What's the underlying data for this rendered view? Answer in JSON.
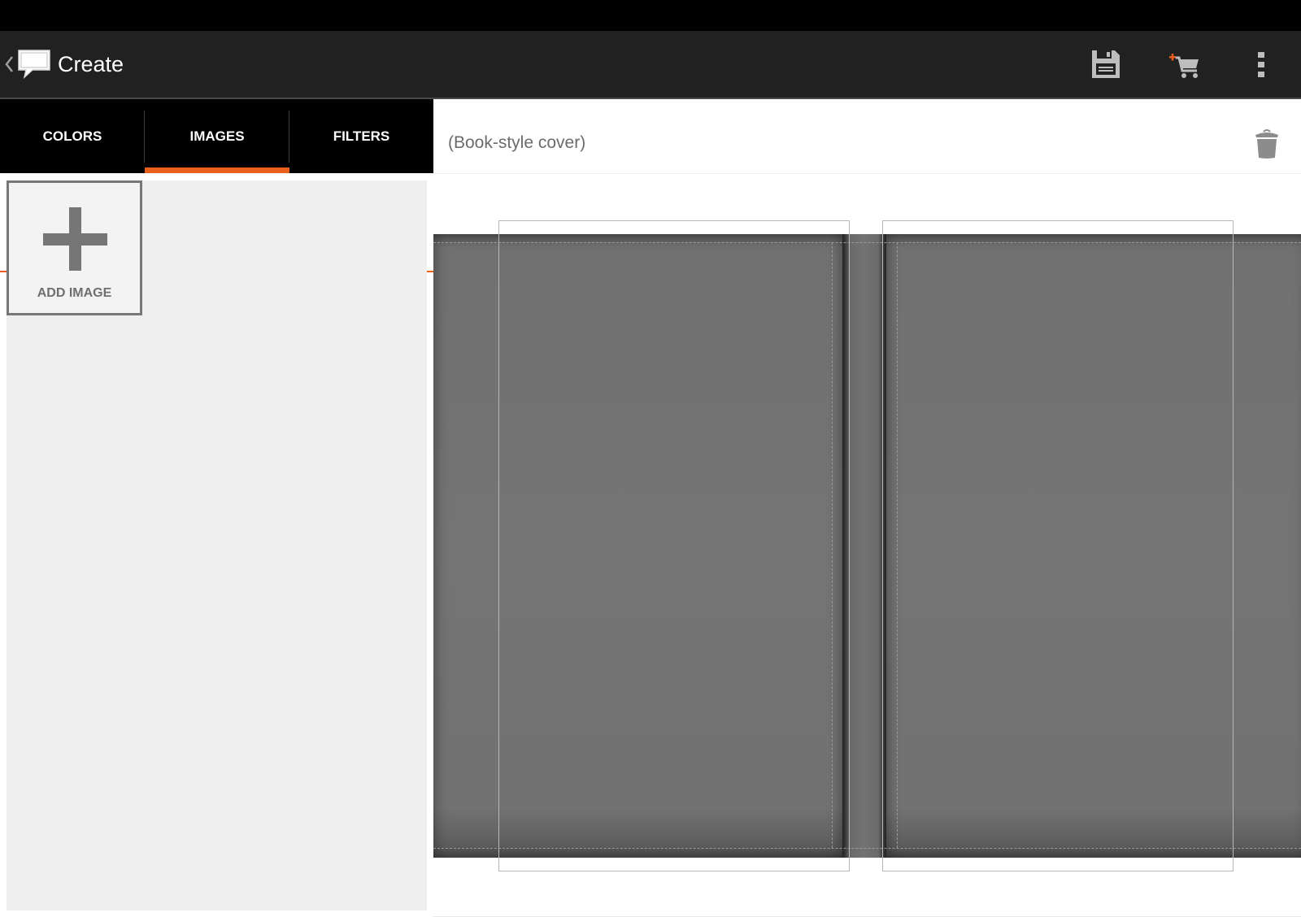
{
  "action_bar": {
    "title": "Create",
    "icons": {
      "up": "chevron-left-icon",
      "app": "speech-bubble-icon",
      "save": "floppy-disk-icon",
      "cart": "add-to-cart-icon",
      "overflow": "overflow-menu-icon"
    }
  },
  "tabs": [
    {
      "label": "COLORS",
      "selected": false
    },
    {
      "label": "IMAGES",
      "selected": true
    },
    {
      "label": "FILTERS",
      "selected": false
    }
  ],
  "left_panel": {
    "add_image_label": "ADD IMAGE"
  },
  "editor": {
    "cover_title": "(Book-style cover)",
    "delete_icon": "trash-icon"
  },
  "colors": {
    "accent": "#e8601c",
    "action_bar_bg": "#212121",
    "tabs_bg": "#000000",
    "panel_bg": "#efefef",
    "cover_gray": "#747474"
  }
}
